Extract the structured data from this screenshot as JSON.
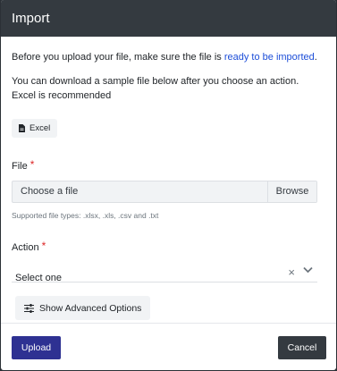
{
  "header": {
    "title": "Import"
  },
  "intro": {
    "text": "Before you upload your file, make sure the file is ",
    "link": "ready to be imported",
    "suffix": "."
  },
  "sample_text": "You can download a sample file below after you choose an action. Excel is recommended",
  "sample_button": {
    "label": "Excel",
    "icon": "file-icon"
  },
  "file_field": {
    "label": "File",
    "required_mark": "*",
    "placeholder": "Choose a file",
    "browse_label": "Browse",
    "hint": "Supported file types: .xlsx, .xls, .csv and .txt"
  },
  "action_field": {
    "label": "Action",
    "required_mark": "*",
    "selected": "Select one",
    "clear_icon": "×"
  },
  "advanced_button": {
    "label": "Show Advanced Options",
    "icon": "sliders-icon"
  },
  "footer": {
    "upload_label": "Upload",
    "cancel_label": "Cancel"
  },
  "colors": {
    "header": "#343a40",
    "primary": "#2e3192",
    "link": "#1d4ed8",
    "required": "#dc2626"
  }
}
